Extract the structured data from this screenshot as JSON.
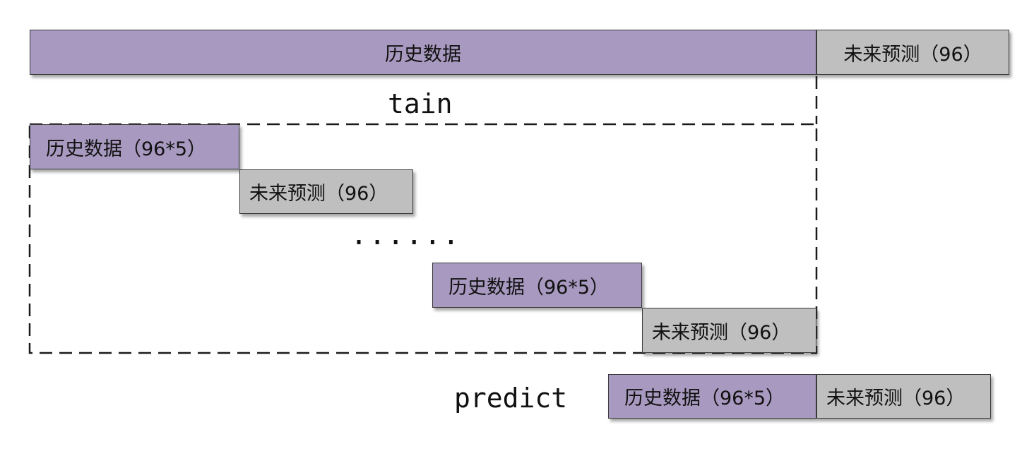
{
  "top_row": {
    "history_label": "历史数据",
    "future_label": "未来预测（96）"
  },
  "train_section": {
    "label": "tain",
    "ellipsis": "......",
    "window_1": {
      "history_label": "历史数据（96*5）",
      "future_label": "未来预测（96）"
    },
    "window_n": {
      "history_label": "历史数据（96*5）",
      "future_label": "未来预测（96）"
    }
  },
  "predict_section": {
    "label": "predict",
    "history_label": "历史数据（96*5）",
    "future_label": "未来预测（96）"
  },
  "colors": {
    "history_fill": "#a799bf",
    "future_fill": "#bfbfbf",
    "border": "#3a3a3a",
    "dash_line": "#1a1a1a"
  }
}
